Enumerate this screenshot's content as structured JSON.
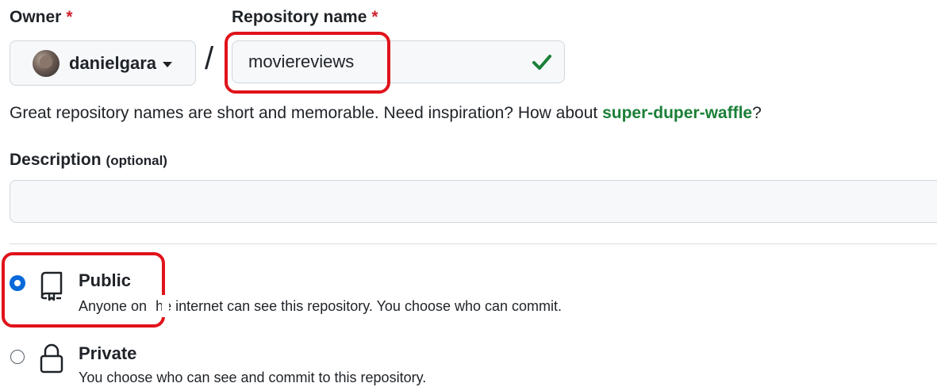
{
  "owner": {
    "label": "Owner",
    "required_mark": "*",
    "selected": "danielgara"
  },
  "repository": {
    "label": "Repository name",
    "required_mark": "*",
    "separator": "/",
    "value": "moviereviews",
    "valid": true
  },
  "hint": {
    "prefix": "Great repository names are short and memorable. Need inspiration? How about ",
    "suggestion": "super-duper-waffle",
    "suffix": "?"
  },
  "description": {
    "label": "Description",
    "optional": "(optional)",
    "value": ""
  },
  "visibility": {
    "options": [
      {
        "id": "public",
        "title": "Public",
        "desc_before": "Anyone on",
        "desc_after": "he internet can see this repository. You choose who can commit.",
        "selected": true,
        "icon": "repo-icon"
      },
      {
        "id": "private",
        "title": "Private",
        "desc": "You choose who can see and commit to this repository.",
        "selected": false,
        "icon": "lock-icon"
      }
    ]
  },
  "colors": {
    "accent": "#0969da",
    "success": "#1a7f37",
    "required": "#cf222e",
    "annotation": "#e0131b"
  }
}
